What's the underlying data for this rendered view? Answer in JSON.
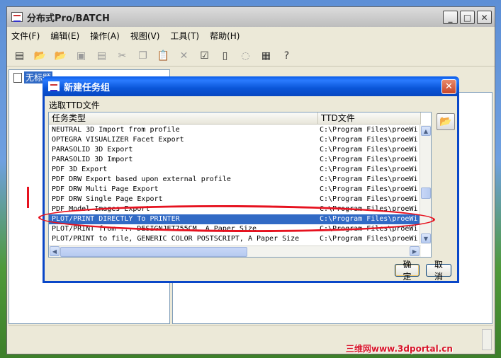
{
  "main_window": {
    "title": "分布式Pro/BATCH",
    "menu": [
      "文件(F)",
      "编辑(E)",
      "操作(A)",
      "视图(V)",
      "工具(T)",
      "帮助(H)"
    ],
    "toolbar_icons": [
      "list-icon",
      "open-folder-icon",
      "open-folder-2-icon",
      "save-icon",
      "save-all-icon",
      "cut-icon",
      "copy-icon",
      "paste-icon",
      "delete-icon",
      "properties-icon",
      "document-icon",
      "lightbulb-icon",
      "stack-icon",
      "help-icon"
    ],
    "tree_item": "无标题"
  },
  "dialog": {
    "title": "新建任务组",
    "label": "选取TTD文件",
    "columns": [
      "任务类型",
      "TTD文件"
    ],
    "rows": [
      {
        "type": "NEUTRAL 3D Import from profile",
        "file": "C:\\Program Files\\proeWi"
      },
      {
        "type": "OPTEGRA VISUALIZER Facet Export",
        "file": "C:\\Program Files\\proeWi"
      },
      {
        "type": "PARASOLID 3D  Export",
        "file": "C:\\Program Files\\proeWi"
      },
      {
        "type": "PARASOLID 3D Import",
        "file": "C:\\Program Files\\proeWi"
      },
      {
        "type": "PDF 3D Export",
        "file": "C:\\Program Files\\proeWi"
      },
      {
        "type": "PDF DRW Export based upon external profile",
        "file": "C:\\Program Files\\proeWi"
      },
      {
        "type": "PDF DRW Multi Page Export",
        "file": "C:\\Program Files\\proeWi"
      },
      {
        "type": "PDF DRW Single Page Export",
        "file": "C:\\Program Files\\proeWi"
      },
      {
        "type": "PDF Model Images Export",
        "file": "C:\\Program Files\\proeWi"
      },
      {
        "type": "PLOT/PRINT DIRECTLY To PRINTER",
        "file": "C:\\Program Files\\proeWi",
        "selected": true
      },
      {
        "type": "PLOT/PRINT from ... DESIGNJET755CM, A Paper Size",
        "file": "C:\\Program Files\\proeWi"
      },
      {
        "type": "PLOT/PRINT to file, GENERIC COLOR POSTSCRIPT, A Paper Size",
        "file": "C:\\Program Files\\proeWi"
      }
    ],
    "ok_label": "确定",
    "cancel_label": "取消"
  },
  "watermark": "三维网www.3dportal.cn",
  "colors": {
    "annotation_red": "#e6121f",
    "selection": "#316ac5",
    "dialog_title": "#0a55d8"
  }
}
